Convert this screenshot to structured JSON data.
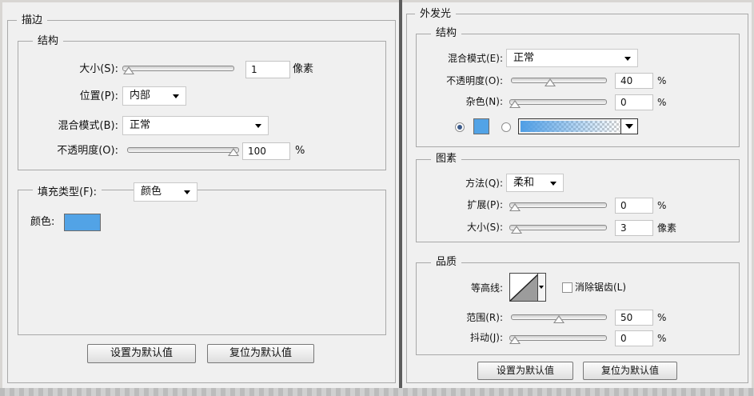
{
  "stroke": {
    "legend": "描边",
    "structure": {
      "legend": "结构",
      "size_label": "大小(S):",
      "size_value": "1",
      "size_slider_fraction": 0.01,
      "size_unit": "像素",
      "position_label": "位置(P):",
      "position_value": "内部",
      "blend_label": "混合模式(B):",
      "blend_value": "正常",
      "opacity_label": "不透明度(O):",
      "opacity_value": "100",
      "opacity_slider_fraction": 1.0,
      "opacity_unit": "%"
    },
    "fill": {
      "type_label": "填充类型(F):",
      "type_value": "颜色",
      "color_label": "颜色:",
      "color_swatch": "#52a3e6"
    },
    "buttons": {
      "set_default": "设置为默认值",
      "reset_default": "复位为默认值"
    }
  },
  "outer_glow": {
    "legend": "外发光",
    "structure": {
      "legend": "结构",
      "blend_label": "混合模式(E):",
      "blend_value": "正常",
      "opacity_label": "不透明度(O):",
      "opacity_value": "40",
      "opacity_slider_fraction": 0.4,
      "opacity_unit": "%",
      "noise_label": "杂色(N):",
      "noise_value": "0",
      "noise_slider_fraction": 0.0,
      "noise_unit": "%",
      "color_swatch": "#52a3e6",
      "solid_selected": true
    },
    "elements": {
      "legend": "图素",
      "technique_label": "方法(Q):",
      "technique_value": "柔和",
      "spread_label": "扩展(P):",
      "spread_value": "0",
      "spread_slider_fraction": 0.0,
      "spread_unit": "%",
      "size_label": "大小(S):",
      "size_value": "3",
      "size_slider_fraction": 0.02,
      "size_unit": "像素"
    },
    "quality": {
      "legend": "品质",
      "contour_label": "等高线:",
      "antialias_label": "消除锯齿(L)",
      "antialias_checked": false,
      "range_label": "范围(R):",
      "range_value": "50",
      "range_slider_fraction": 0.5,
      "range_unit": "%",
      "jitter_label": "抖动(J):",
      "jitter_value": "0",
      "jitter_slider_fraction": 0.0,
      "jitter_unit": "%"
    },
    "buttons": {
      "set_default": "设置为默认值",
      "reset_default": "复位为默认值"
    }
  }
}
